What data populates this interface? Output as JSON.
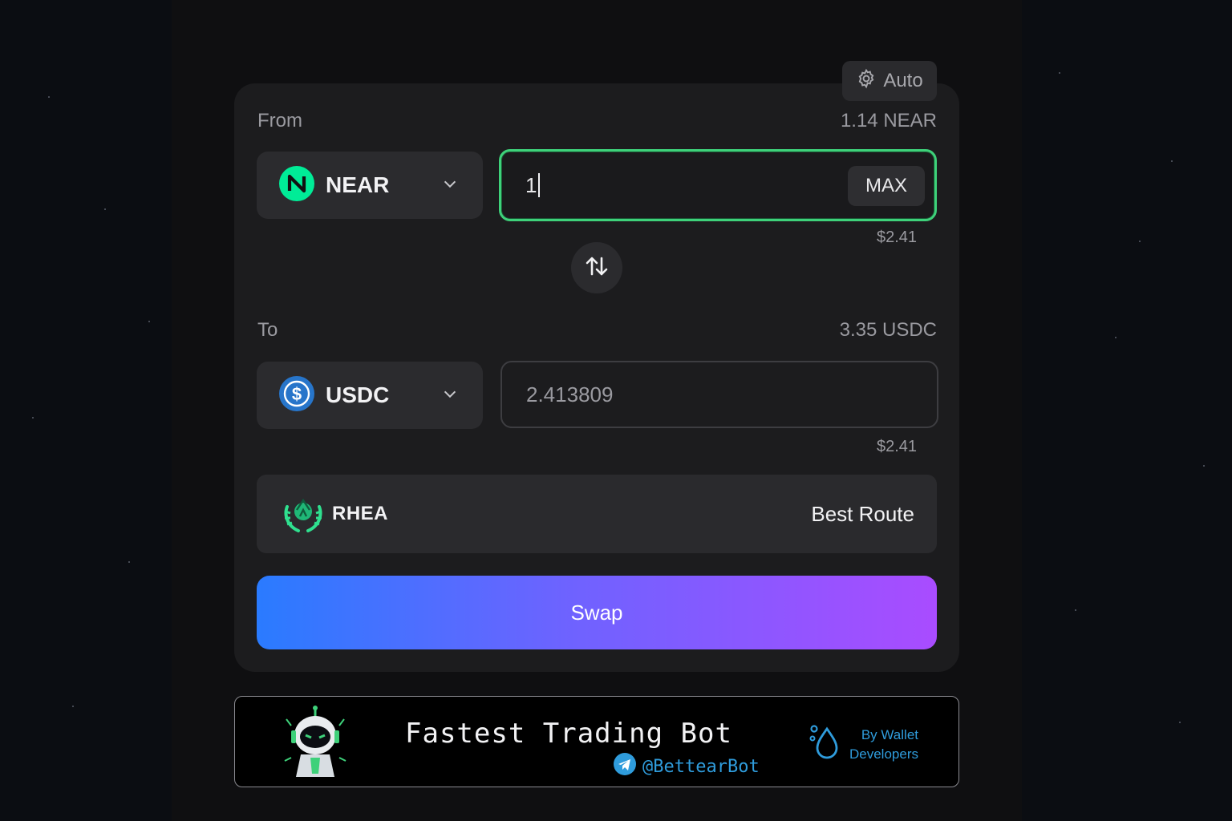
{
  "settings": {
    "label": "Auto",
    "icon": "gear-icon"
  },
  "from": {
    "label": "From",
    "balance": "1.14 NEAR",
    "token": "NEAR",
    "token_icon": "near-logo-icon",
    "amount": "1",
    "max_label": "MAX",
    "usd_value": "$2.41"
  },
  "flip": {
    "icon": "swap-vertical-arrows-icon"
  },
  "to": {
    "label": "To",
    "balance": "3.35 USDC",
    "token": "USDC",
    "token_icon": "usdc-logo-icon",
    "amount": "2.413809",
    "usd_value": "$2.41"
  },
  "route": {
    "dex": "RHEA",
    "dex_icon": "rhea-logo-icon",
    "label": "Best Route"
  },
  "swap_button": {
    "label": "Swap"
  },
  "banner": {
    "title": "Fastest Trading Bot",
    "handle": "@BettearBot",
    "by_line1": "By Wallet",
    "by_line2": "Developers",
    "icons": [
      "robot-mascot-icon",
      "telegram-icon",
      "droplet-logo-icon"
    ]
  },
  "colors": {
    "accent_green": "#3ed17a",
    "swap_gradient_start": "#2a7bff",
    "swap_gradient_end": "#a94cff",
    "link_blue": "#2f9cdc"
  }
}
